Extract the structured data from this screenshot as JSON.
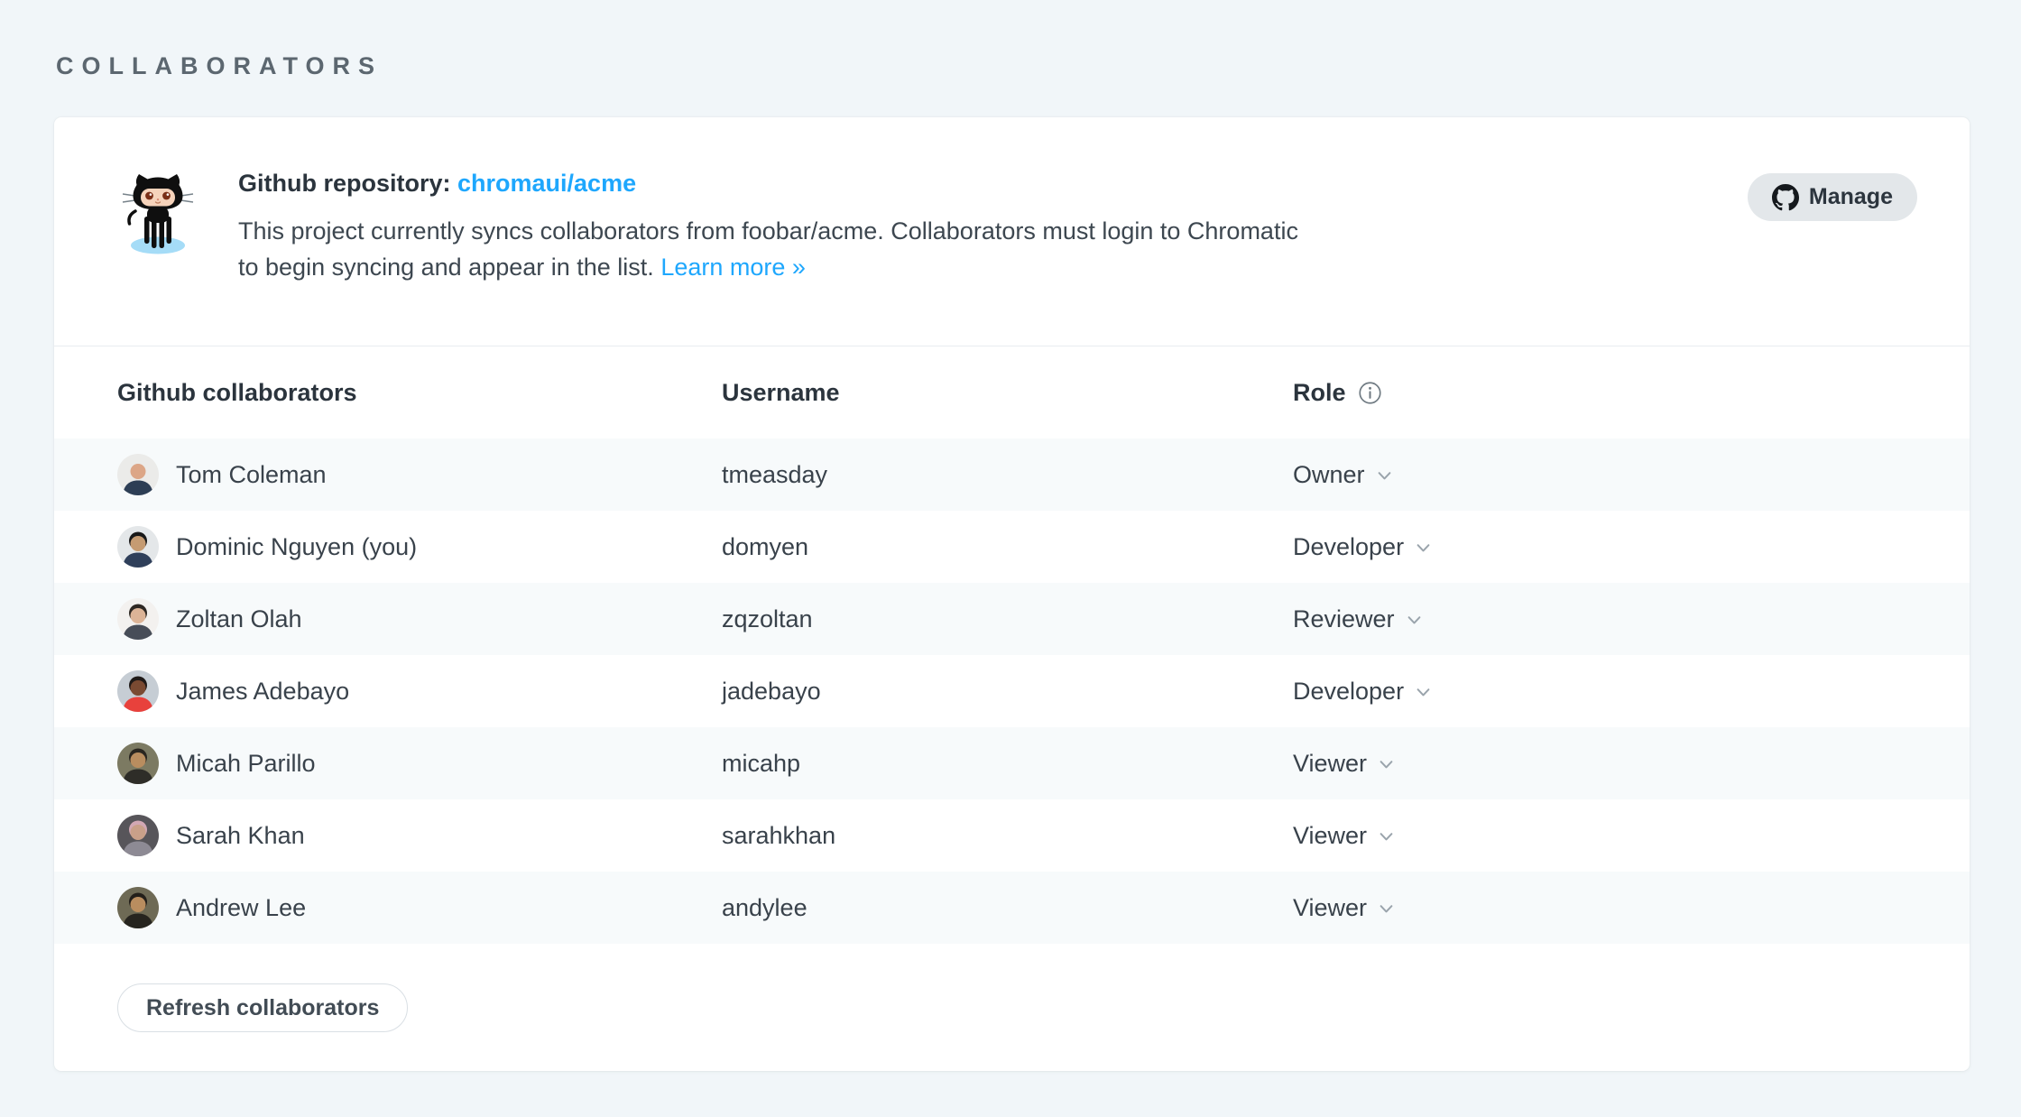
{
  "page": {
    "title": "COLLABORATORS"
  },
  "colors": {
    "page_background": "#f1f6f9",
    "card_background": "#ffffff",
    "row_stripe": "#f7fafb",
    "link_blue": "#1ea7fd",
    "heading_gray": "#5c6770",
    "text_dark": "#2b343d",
    "text_body": "#3d4750",
    "manage_button_bg": "#e3e7ea",
    "divider": "#e9edf0"
  },
  "github_panel": {
    "octocat_icon": "github-octocat-illustration",
    "title_label": "Github repository:",
    "repo_link": "chromaui/acme",
    "description": "This project currently syncs collaborators from foobar/acme. Collaborators must login to Chromatic to begin syncing and appear in the list.",
    "learn_more_label": "Learn more »",
    "manage_button": {
      "label": "Manage",
      "icon": "github-mark-icon"
    }
  },
  "table": {
    "headers": {
      "collaborators": "Github collaborators",
      "username": "Username",
      "role": "Role",
      "role_info_icon": "info-icon"
    },
    "rows": [
      {
        "name": "Tom Coleman",
        "username": "tmeasday",
        "role": "Owner",
        "avatar": {
          "bg": "#ebebe9",
          "skin": "#dca687",
          "shirt": "#2d3e55",
          "hair": "none"
        }
      },
      {
        "name": "Dominic Nguyen (you)",
        "username": "domyen",
        "role": "Developer",
        "avatar": {
          "bg": "#e4e7e9",
          "skin": "#c59b72",
          "shirt": "#2f3f5a",
          "hair": "#191919"
        }
      },
      {
        "name": "Zoltan Olah",
        "username": "zqzoltan",
        "role": "Reviewer",
        "avatar": {
          "bg": "#f3f1ef",
          "skin": "#dcb497",
          "shirt": "#474d58",
          "hair": "#2e2823"
        }
      },
      {
        "name": "James Adebayo",
        "username": "jadebayo",
        "role": "Developer",
        "avatar": {
          "bg": "#c6cdd4",
          "skin": "#7a4a32",
          "shirt": "#e8413c",
          "hair": "#1f1a18"
        }
      },
      {
        "name": "Micah Parillo",
        "username": "micahp",
        "role": "Viewer",
        "avatar": {
          "bg": "#7c7a62",
          "skin": "#b98d5f",
          "shirt": "#2e2d28",
          "hair": "#2a2620"
        }
      },
      {
        "name": "Sarah Khan",
        "username": "sarahkhan",
        "role": "Viewer",
        "avatar": {
          "bg": "#57555a",
          "skin": "#c9a089",
          "shirt": "#8d8a94",
          "hair": "#d2a8b4"
        }
      },
      {
        "name": "Andrew Lee",
        "username": "andylee",
        "role": "Viewer",
        "avatar": {
          "bg": "#6e6a55",
          "skin": "#b98d5f",
          "shirt": "#26241f",
          "hair": "#231f1a"
        }
      }
    ]
  },
  "footer": {
    "refresh_button_label": "Refresh collaborators"
  }
}
